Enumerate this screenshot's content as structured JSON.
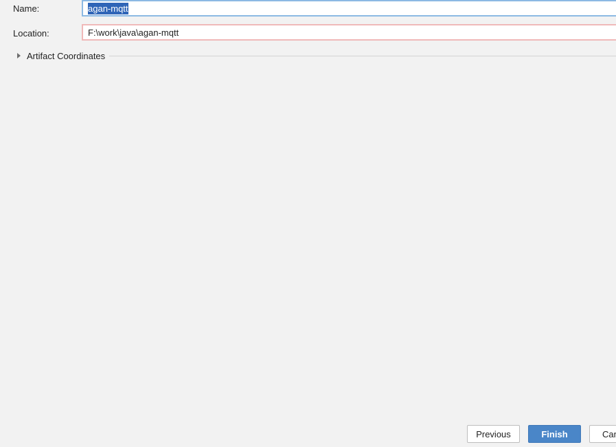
{
  "form": {
    "name_label": "Name:",
    "name_value": "agan-mqtt",
    "location_label": "Location:",
    "location_value": "F:\\work\\java\\agan-mqtt"
  },
  "artifact_section": {
    "title": "Artifact Coordinates",
    "expanded": false
  },
  "buttons": {
    "previous": "Previous",
    "finish": "Finish",
    "cancel": "Cancel"
  },
  "colors": {
    "background": "#f2f2f2",
    "name_focus_border": "#8cb9e3",
    "location_error_border": "#f0b9b9",
    "selection": "#2f65b7",
    "primary_button": "#4a86c8"
  }
}
